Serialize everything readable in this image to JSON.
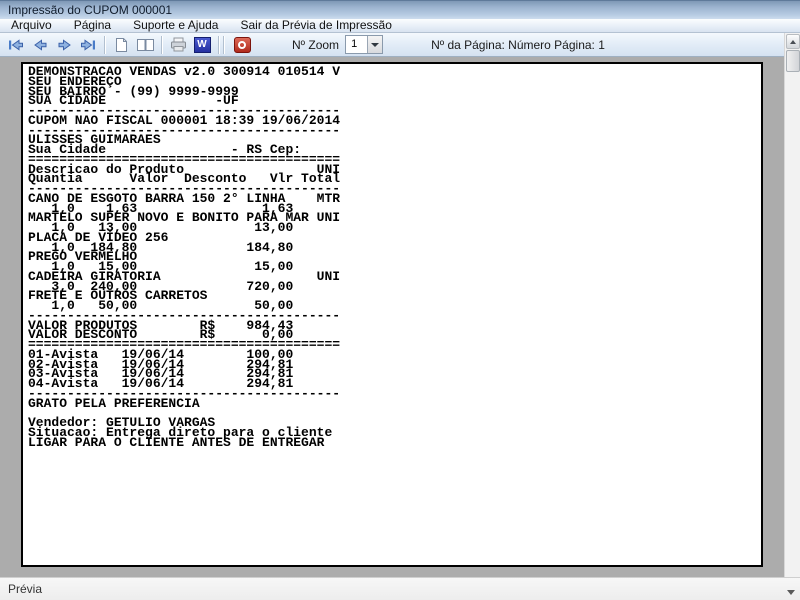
{
  "window": {
    "title": "Impressão do CUPOM 000001"
  },
  "menu": {
    "items": [
      {
        "label": "Arquivo"
      },
      {
        "label": "Página"
      },
      {
        "label": "Suporte e Ajuda"
      },
      {
        "label": "Sair da Prévia de Impressão"
      }
    ]
  },
  "toolbar": {
    "zoom_label": "Nº Zoom",
    "zoom_value": "1",
    "page_info": "Nº da Página: Número Página: 1",
    "word_icon_letter": "W",
    "icons": [
      "first-page-icon",
      "previous-page-icon",
      "next-page-icon",
      "last-page-icon",
      "single-page-icon",
      "two-pages-icon",
      "print-icon",
      "export-word-icon",
      "close-preview-icon"
    ]
  },
  "receipt": {
    "lines": [
      "DEMONSTRACAO VENDAS v2.0 300914 010514 V",
      "SEU ENDEREÇO",
      "SEU BAIRRO - (99) 9999-9999",
      "SUA CIDADE              -UF",
      "----------------------------------------",
      "CUPOM NAO FISCAL 000001 18:39 19/06/2014",
      "----------------------------------------",
      "ULISSES GUIMARAES",
      "Sua Cidade                - RS Cep:",
      "========================================",
      "Descricao do Produto                 UNI",
      "Quantia      Valor  Desconto   Vlr Total",
      "----------------------------------------",
      "CANO DE ESGOTO BARRA 150 2° LINHA    MTR",
      "   1,0    1,63                1,63",
      "MARTELO SUPER NOVO E BONITO PARA MAR UNI",
      "   1,0   13,00               13,00",
      "PLACA DE VÍDEO 256",
      "   1,0  184,80              184,80",
      "PREGO VERMELHO",
      "   1,0   15,00               15,00",
      "CADEIRA GIRATORIA                    UNI",
      "   3,0  240,00              720,00",
      "FRETE E OUTROS CARRETOS",
      "   1,0   50,00               50,00",
      "----------------------------------------",
      "VALOR PRODUTOS        R$    984,43",
      "VALOR DESCONTO        R$      0,00",
      "========================================",
      "01-Avista   19/06/14        100,00",
      "02-Avista   19/06/14        294,81",
      "03-Avista   19/06/14        294,81",
      "04-Avista   19/06/14        294,81",
      "----------------------------------------",
      "GRATO PELA PREFERENCIA",
      "",
      "Vendedor: GETULIO VARGAS",
      "Situacao: Entrega direto para o cliente",
      "LIGAR PARA O CLIENTE ANTES DE ENTREGAR"
    ]
  },
  "status": {
    "text": "Prévia"
  },
  "colors": {
    "accent_blue": "#4a7cc8",
    "word_blue": "#2e3fbe",
    "close_red": "#b02a1c",
    "workspace_gray": "#acacac"
  }
}
